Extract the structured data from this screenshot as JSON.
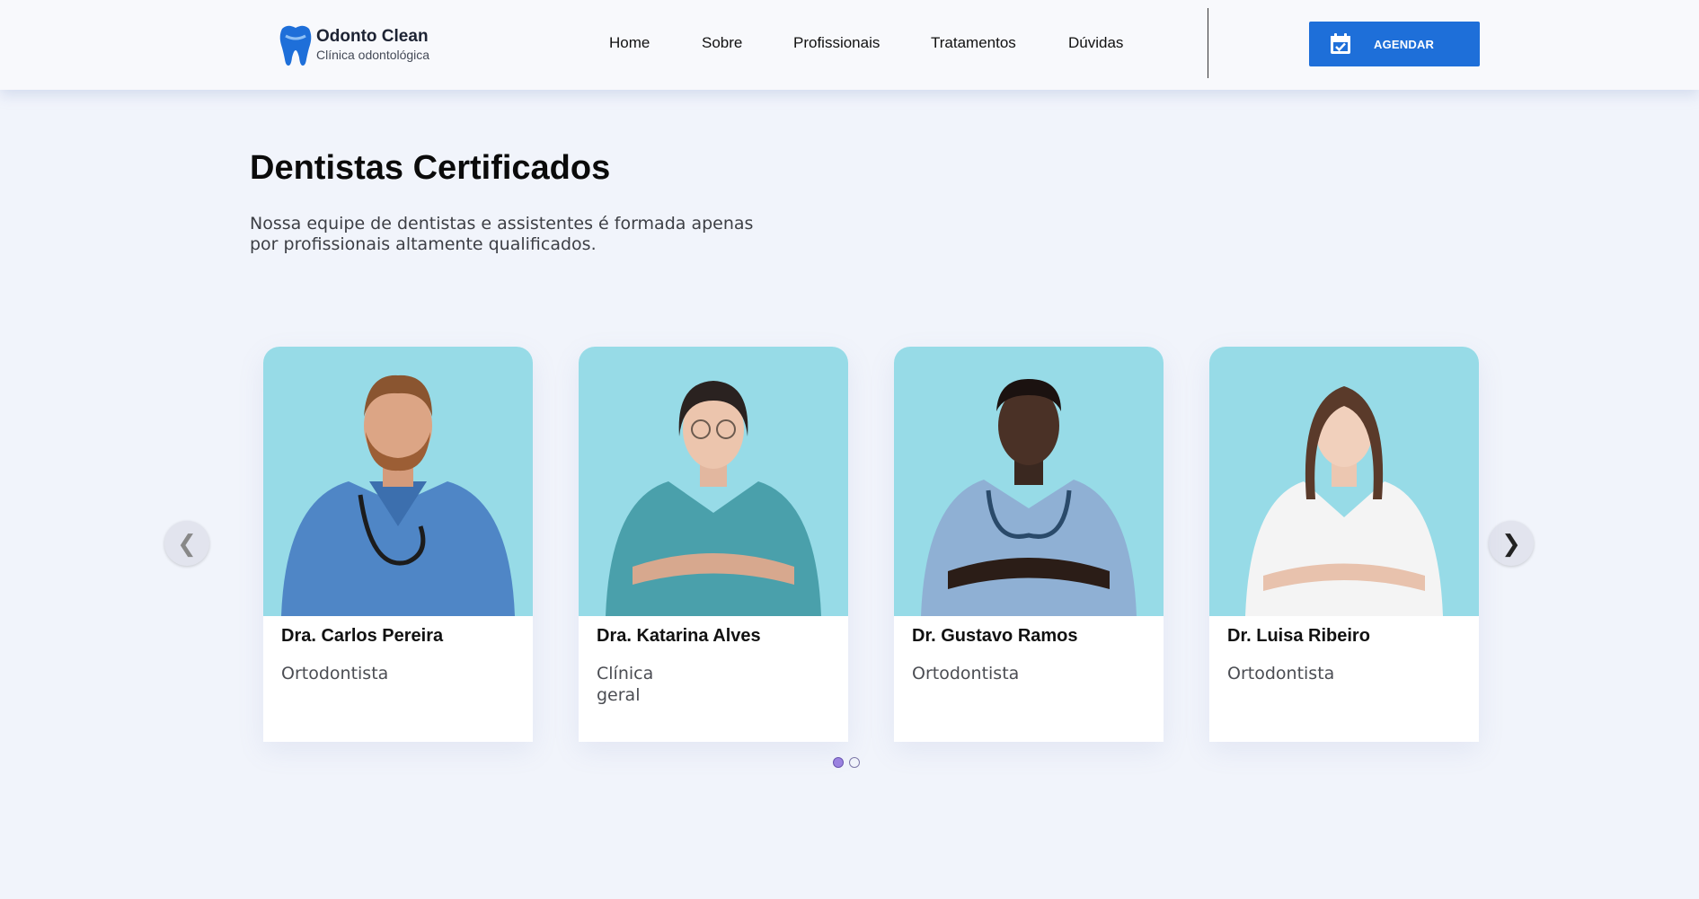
{
  "brand": {
    "name": "Odonto Clean",
    "tagline": "Clínica odontológica"
  },
  "nav": {
    "items": [
      "Home",
      "Sobre",
      "Profissionais",
      "Tratamentos",
      "Dúvidas"
    ]
  },
  "header": {
    "cta_label": "AGENDAR"
  },
  "section": {
    "title": "Dentistas Certificados",
    "description": "Nossa equipe de dentistas e assistentes é formada apenas por profissionais altamente qualificados."
  },
  "carousel": {
    "prev_label": "❮",
    "next_label": "❯",
    "cards": [
      {
        "name": "Dra. Carlos Pereira",
        "role": "Ortodontista"
      },
      {
        "name": "Dra. Katarina Alves",
        "role": "Clínica geral"
      },
      {
        "name": "Dr. Gustavo Ramos",
        "role": "Ortodontista"
      },
      {
        "name": "Dr. Luisa Ribeiro",
        "role": "Ortodontista"
      }
    ],
    "page_count": 2,
    "active_page": 1
  },
  "colors": {
    "accent": "#1e6fd9",
    "photo_bg": "#97dbe7",
    "page_bg": "#f1f4fb",
    "dot_active": "#9b82e0"
  }
}
